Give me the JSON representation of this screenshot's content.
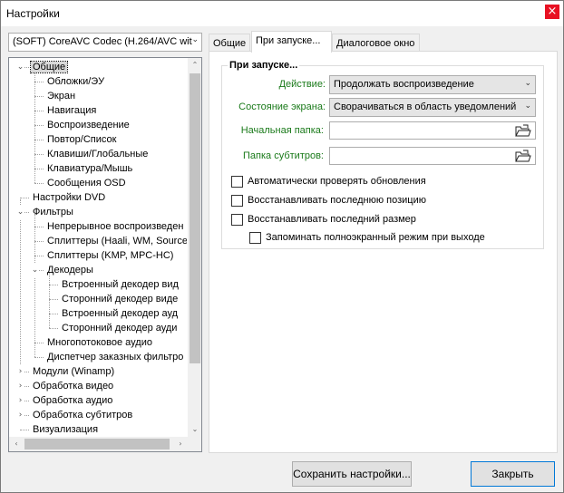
{
  "window": {
    "title": "Настройки",
    "close_glyph": "×"
  },
  "filter_select": {
    "value": "(SOFT) CoreAVC Codec (H.264/AVC wit",
    "arrow_glyph": "⌄"
  },
  "tree": {
    "items": [
      {
        "label": "Общие",
        "level": 0,
        "expander": "⌄",
        "selected": true
      },
      {
        "label": "Обложки/ЭУ",
        "level": 1
      },
      {
        "label": "Экран",
        "level": 1
      },
      {
        "label": "Навигация",
        "level": 1
      },
      {
        "label": "Воспроизведение",
        "level": 1
      },
      {
        "label": "Повтор/Список",
        "level": 1
      },
      {
        "label": "Клавиши/Глобальные",
        "level": 1
      },
      {
        "label": "Клавиатура/Мышь",
        "level": 1
      },
      {
        "label": "Сообщения OSD",
        "level": 1
      },
      {
        "label": "Настройки DVD",
        "level": 0
      },
      {
        "label": "Фильтры",
        "level": 0,
        "expander": "⌄"
      },
      {
        "label": "Непрерывное воспроизведен",
        "level": 1
      },
      {
        "label": "Сплиттеры (Haali, WM, Source",
        "level": 1
      },
      {
        "label": "Сплиттеры (KMP, MPC-HC)",
        "level": 1
      },
      {
        "label": "Декодеры",
        "level": 1,
        "expander": "⌄"
      },
      {
        "label": "Встроенный декодер вид",
        "level": 2
      },
      {
        "label": "Сторонний декодер виде",
        "level": 2
      },
      {
        "label": "Встроенный декодер ауд",
        "level": 2
      },
      {
        "label": "Сторонний декодер ауди",
        "level": 2
      },
      {
        "label": "Многопотоковое аудио",
        "level": 1
      },
      {
        "label": "Диспетчер заказных фильтро",
        "level": 1
      },
      {
        "label": "Модули (Winamp)",
        "level": 0,
        "expander": "›"
      },
      {
        "label": "Обработка видео",
        "level": 0,
        "expander": "›"
      },
      {
        "label": "Обработка аудио",
        "level": 0,
        "expander": "›"
      },
      {
        "label": "Обработка субтитров",
        "level": 0,
        "expander": "›"
      },
      {
        "label": "Визуализация",
        "level": 0
      }
    ],
    "scroll_up": "⌃",
    "scroll_down": "⌄",
    "scroll_left": "‹",
    "scroll_right": "›"
  },
  "tabs": [
    {
      "label": "Общие"
    },
    {
      "label": "При запуске..."
    },
    {
      "label": "Диалоговое окно"
    }
  ],
  "startup": {
    "group_title": "При запуске...",
    "action_label": "Действие:",
    "action_value": "Продолжать воспроизведение",
    "screen_label": "Состояние экрана:",
    "screen_value": "Сворачиваться в область уведомлений",
    "start_folder_label": "Начальная папка:",
    "start_folder_value": "",
    "subs_folder_label": "Папка субтитров:",
    "subs_folder_value": "",
    "combo_arrow": "⌄",
    "checkboxes": [
      {
        "label": "Автоматически проверять обновления",
        "checked": false
      },
      {
        "label": "Восстанавливать последнюю позицию",
        "checked": false
      },
      {
        "label": "Восстанавливать последний размер",
        "checked": false
      },
      {
        "label": "Запоминать полноэкранный режим при выходе",
        "checked": false
      }
    ]
  },
  "footer": {
    "save_label": "Сохранить настройки...",
    "close_label": "Закрыть"
  },
  "colors": {
    "label_green": "#1a7a1a",
    "close_red": "#e81123",
    "focus_blue": "#0078d7"
  }
}
